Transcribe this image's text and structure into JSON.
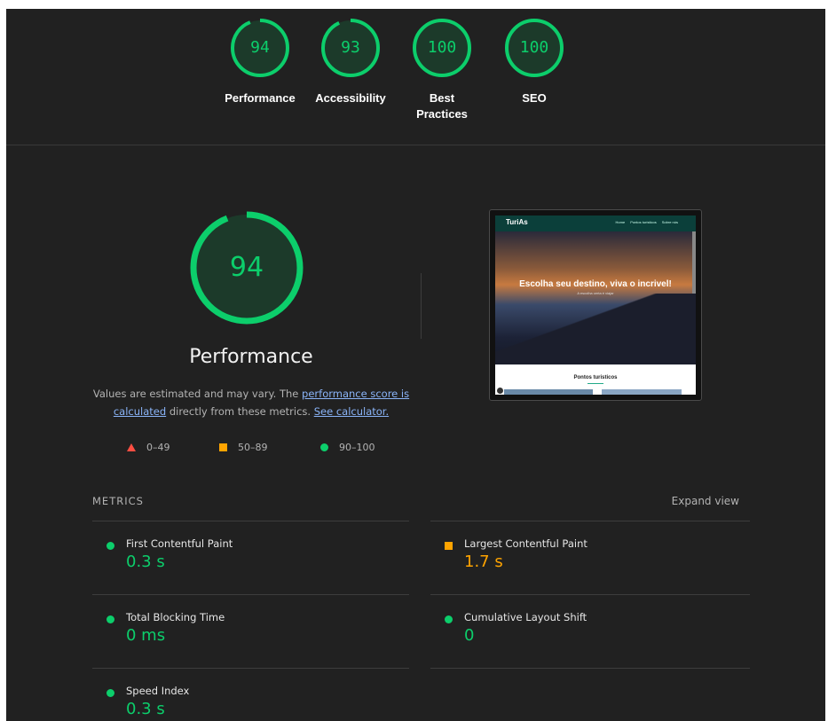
{
  "top_gauges": [
    {
      "score": "94",
      "label": "Performance"
    },
    {
      "score": "93",
      "label": "Accessibility"
    },
    {
      "score": "100",
      "label": "Best Practices"
    },
    {
      "score": "100",
      "label": "SEO"
    }
  ],
  "performance": {
    "score": "94",
    "title": "Performance",
    "desc_part1": "Values are estimated and may vary. The ",
    "desc_link1": "performance score is calculated",
    "desc_part2": " directly from these metrics. ",
    "desc_link2": "See calculator."
  },
  "legend": {
    "fail": "0–49",
    "average": "50–89",
    "pass": "90–100"
  },
  "screenshot": {
    "brand": "TuriAs",
    "nav_links": [
      "Home",
      "Pontos turísticos",
      "Sobre nós"
    ],
    "headline": "Escolha seu destino, viva o incrivel!",
    "subline": "A escolha certa é viajar",
    "section_title": "Pontos turisticos"
  },
  "metrics": {
    "header": "METRICS",
    "expand": "Expand view",
    "items": [
      {
        "name": "First Contentful Paint",
        "value": "0.3 s",
        "status": "pass"
      },
      {
        "name": "Largest Contentful Paint",
        "value": "1.7 s",
        "status": "average"
      },
      {
        "name": "Total Blocking Time",
        "value": "0 ms",
        "status": "pass"
      },
      {
        "name": "Cumulative Layout Shift",
        "value": "0",
        "status": "pass"
      },
      {
        "name": "Speed Index",
        "value": "0.3 s",
        "status": "pass"
      }
    ]
  },
  "colors": {
    "pass": "#0cce6b",
    "average": "#ffa400",
    "fail": "#ff4e42",
    "background": "#212121"
  },
  "score_fraction": {
    "performance": 0.94,
    "accessibility": 0.93,
    "best_practices": 1.0,
    "seo": 1.0
  }
}
